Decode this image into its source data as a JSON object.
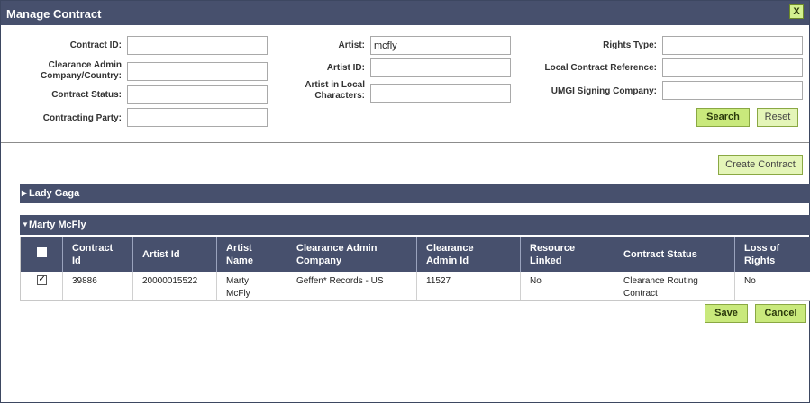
{
  "dialog": {
    "title": "Manage Contract",
    "close_label": "X"
  },
  "search_form": {
    "contract_id": {
      "label": "Contract ID:",
      "value": ""
    },
    "clearance_admin": {
      "label_line1": "Clearance Admin",
      "label_line2": "Company/Country:",
      "value": ""
    },
    "contract_status": {
      "label": "Contract Status:",
      "value": ""
    },
    "contracting_party": {
      "label": "Contracting Party:",
      "value": ""
    },
    "artist": {
      "label": "Artist:",
      "value": "mcfly"
    },
    "artist_id": {
      "label": "Artist ID:",
      "value": ""
    },
    "artist_local": {
      "label_line1": "Artist in Local",
      "label_line2": "Characters:",
      "value": ""
    },
    "rights_type": {
      "label": "Rights Type:",
      "value": ""
    },
    "local_contract_ref": {
      "label": "Local Contract Reference:",
      "value": ""
    },
    "umgi_signing": {
      "label": "UMGI Signing Company:",
      "value": ""
    },
    "search_label": "Search",
    "reset_label": "Reset"
  },
  "actions": {
    "create_contract_label": "Create Contract",
    "save_label": "Save",
    "cancel_label": "Cancel"
  },
  "artist_groups": [
    {
      "name": "Lady Gaga",
      "expanded": false
    },
    {
      "name": "Marty McFly",
      "expanded": true
    }
  ],
  "contracts_table": {
    "columns": [
      {
        "l1": "",
        "l2": ""
      },
      {
        "l1": "Contract",
        "l2": "Id"
      },
      {
        "l1": "Artist Id",
        "l2": ""
      },
      {
        "l1": "Artist",
        "l2": "Name"
      },
      {
        "l1": "Clearance Admin",
        "l2": "Company"
      },
      {
        "l1": "Clearance",
        "l2": "Admin Id"
      },
      {
        "l1": "Resource",
        "l2": "Linked"
      },
      {
        "l1": "Contract Status",
        "l2": ""
      },
      {
        "l1": "Loss of",
        "l2": "Rights"
      }
    ],
    "rows": [
      {
        "selected": true,
        "contract_id": "39886",
        "artist_id": "20000015522",
        "artist_name_l1": "Marty",
        "artist_name_l2": "McFly",
        "clearance_admin_company": "Geffen* Records - US",
        "clearance_admin_id": "11527",
        "resource_linked": "No",
        "status_l1": "Clearance Routing",
        "status_l2": "Contract",
        "loss_of_rights": "No"
      }
    ]
  }
}
